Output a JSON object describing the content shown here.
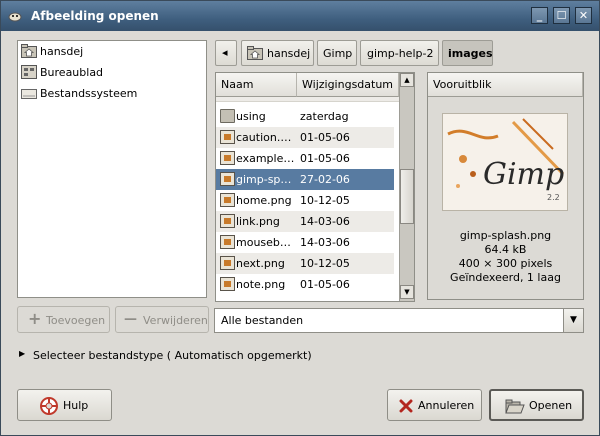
{
  "window": {
    "title": "Afbeelding openen",
    "controls": [
      "_",
      "☐",
      "✕"
    ]
  },
  "places": [
    {
      "label": "hansdej",
      "icon": "home-folder-icon"
    },
    {
      "label": "Bureaublad",
      "icon": "desktop-icon"
    },
    {
      "label": "Bestandssysteem",
      "icon": "drive-icon"
    }
  ],
  "path": {
    "back_glyph": "◂",
    "crumbs": [
      "hansdej",
      "Gimp",
      "gimp-help-2",
      "images"
    ]
  },
  "file_list": {
    "columns": [
      "Naam",
      "Wijzigingsdatum"
    ],
    "rows": [
      {
        "name": "using",
        "date": "zaterdag",
        "type": "folder"
      },
      {
        "name": "caution.…",
        "date": "01-05-06",
        "type": "image"
      },
      {
        "name": "example…",
        "date": "01-05-06",
        "type": "image"
      },
      {
        "name": "gimp-sp…",
        "date": "27-02-06",
        "type": "image",
        "selected": true
      },
      {
        "name": "home.png",
        "date": "10-12-05",
        "type": "image"
      },
      {
        "name": "link.png",
        "date": "14-03-06",
        "type": "image"
      },
      {
        "name": "mouseb…",
        "date": "14-03-06",
        "type": "image"
      },
      {
        "name": "next.png",
        "date": "10-12-05",
        "type": "image"
      },
      {
        "name": "note.png",
        "date": "01-05-06",
        "type": "image"
      }
    ]
  },
  "preview": {
    "header": "Vooruitblik",
    "filename": "gimp-splash.png",
    "size": "64.4 kB",
    "dimensions": "400 × 300 pixels",
    "info": "Geïndexeerd, 1 laag"
  },
  "actions": {
    "add_label": "Toevoegen",
    "remove_label": "Verwijderen",
    "filter_value": "Alle bestanden",
    "filetype_expander": "Selecteer bestandstype ( Automatisch opgemerkt)",
    "help_label": "Hulp",
    "cancel_label": "Annuleren",
    "open_label": "Openen"
  },
  "colors": {
    "selection": "#587ba1",
    "titlebar": "#4a6886",
    "window_bg": "#dcdad5"
  }
}
